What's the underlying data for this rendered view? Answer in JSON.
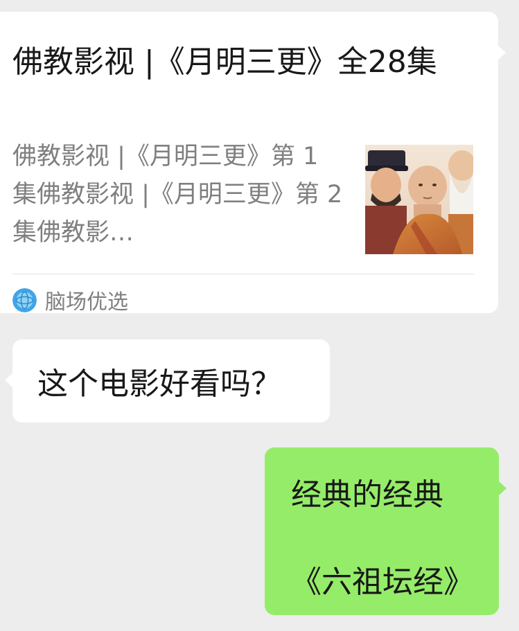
{
  "link_card": {
    "title": "佛教影视 |《月明三更》全28集",
    "description": "佛教影视 |《月明三更》第 1 集佛教影视 |《月明三更》第 2 集佛教影…",
    "thumbnail": "drama-stills-thumbnail",
    "source_icon": "globe-icon",
    "source_name": "脑场优选"
  },
  "messages": {
    "incoming_text": "这个电影好看吗？",
    "outgoing_line1": "经典的经典",
    "outgoing_line2": "《六祖坛经》"
  },
  "colors": {
    "background": "#ededed",
    "bubble_incoming": "#ffffff",
    "bubble_outgoing": "#95ec69",
    "text_primary": "#181818",
    "text_secondary": "#7f7f7f"
  }
}
